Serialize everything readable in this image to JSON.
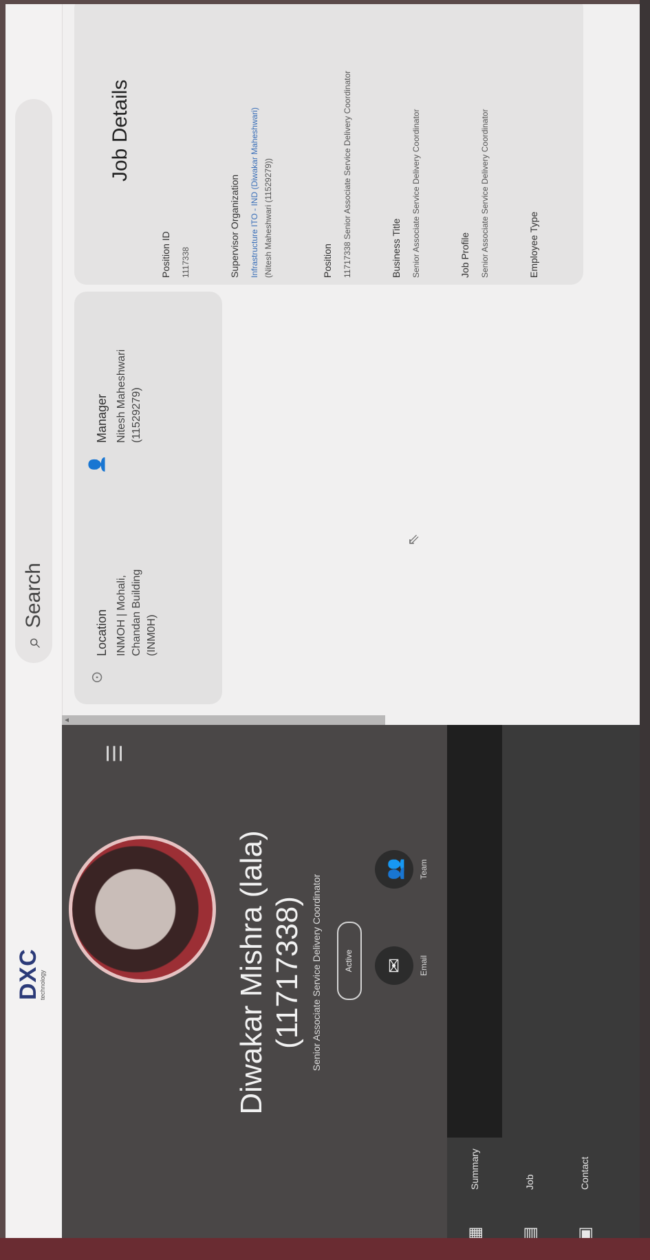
{
  "header": {
    "logo_text": "DXC",
    "logo_sub": "technology",
    "search_placeholder": "Search"
  },
  "profile": {
    "name": "Diwakar Mishra (lala)",
    "employee_id": "(11717338)",
    "title": "Senior Associate Service Delivery Coordinator",
    "badge": "Active",
    "actions": [
      {
        "label": "Email",
        "icon": "email-icon"
      },
      {
        "label": "Team",
        "icon": "team-icon"
      }
    ]
  },
  "nav": {
    "items": [
      {
        "label": "Summary",
        "icon": "summary-icon"
      },
      {
        "label": "Job",
        "icon": "job-icon"
      },
      {
        "label": "Contact",
        "icon": "contact-icon"
      }
    ]
  },
  "location": {
    "label": "Location",
    "lines": [
      "INMOH | Mohali,",
      "Chandan Building",
      "(INM0H)"
    ]
  },
  "manager": {
    "label": "Manager",
    "lines": [
      "Nitesh Maheshwari",
      "(11529279)"
    ]
  },
  "job_details": {
    "title": "Job Details",
    "fields": [
      {
        "label": "Position ID",
        "value": "1117338"
      },
      {
        "label": "Supervisor Organization",
        "value": "Infrastructure ITO - IND (Diwakar Maheshwari)",
        "value2": "(Nitesh Maheshwari (11529279))"
      },
      {
        "label": "Position",
        "value": "11717338 Senior Associate Service Delivery Coordinator"
      },
      {
        "label": "Business Title",
        "value": "Senior Associate Service Delivery Coordinator"
      },
      {
        "label": "Job Profile",
        "value": "Senior Associate Service Delivery Coordinator"
      },
      {
        "label": "Employee Type",
        "value": ""
      }
    ]
  }
}
